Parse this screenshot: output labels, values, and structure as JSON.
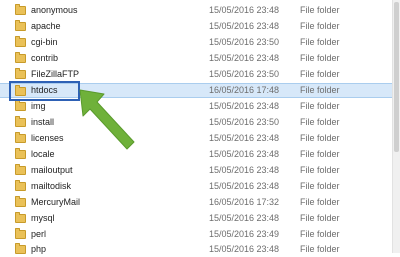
{
  "rows": [
    {
      "name": "anonymous",
      "date": "15/05/2016 23:48",
      "type": "File folder"
    },
    {
      "name": "apache",
      "date": "15/05/2016 23:48",
      "type": "File folder"
    },
    {
      "name": "cgi-bin",
      "date": "15/05/2016 23:50",
      "type": "File folder"
    },
    {
      "name": "contrib",
      "date": "15/05/2016 23:48",
      "type": "File folder"
    },
    {
      "name": "FileZillaFTP",
      "date": "15/05/2016 23:50",
      "type": "File folder"
    },
    {
      "name": "htdocs",
      "date": "16/05/2016 17:48",
      "type": "File folder"
    },
    {
      "name": "img",
      "date": "15/05/2016 23:48",
      "type": "File folder"
    },
    {
      "name": "install",
      "date": "15/05/2016 23:50",
      "type": "File folder"
    },
    {
      "name": "licenses",
      "date": "15/05/2016 23:48",
      "type": "File folder"
    },
    {
      "name": "locale",
      "date": "15/05/2016 23:48",
      "type": "File folder"
    },
    {
      "name": "mailoutput",
      "date": "15/05/2016 23:48",
      "type": "File folder"
    },
    {
      "name": "mailtodisk",
      "date": "15/05/2016 23:48",
      "type": "File folder"
    },
    {
      "name": "MercuryMail",
      "date": "16/05/2016 17:32",
      "type": "File folder"
    },
    {
      "name": "mysql",
      "date": "15/05/2016 23:48",
      "type": "File folder"
    },
    {
      "name": "perl",
      "date": "15/05/2016 23:49",
      "type": "File folder"
    },
    {
      "name": "php",
      "date": "15/05/2016 23:48",
      "type": "File folder"
    }
  ],
  "selected_index": 5,
  "colors": {
    "selection": "#d7e8f9",
    "highlight_border": "#2e61b5",
    "arrow": "#6fb13a",
    "folder": "#eac158"
  },
  "icons": {
    "folder": "folder-icon",
    "arrow": "green-arrow-annotation"
  }
}
